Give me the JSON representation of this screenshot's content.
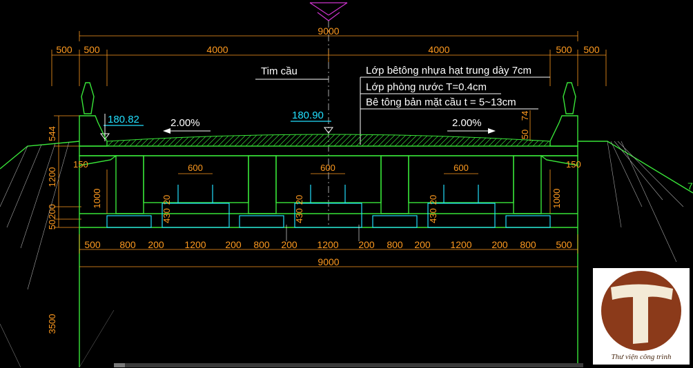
{
  "drawing": {
    "overall_width_top": "9000",
    "overall_width_bottom": "9000",
    "top_segments": [
      "500",
      "500",
      "4000",
      "4000",
      "500",
      "500"
    ],
    "bottom_segments": [
      "500",
      "800",
      "200",
      "1200",
      "200",
      "800",
      "200",
      "1200",
      "200",
      "800",
      "200",
      "1200",
      "200",
      "800",
      "500"
    ],
    "center_label": "Tim cầu",
    "layers": [
      "Lớp bêtông nhựa hạt trung dày 7cm",
      "Lớp phòng nước T=0.4cm",
      "Bê tông bản mặt cầu  t = 5~13cm"
    ],
    "elevation_left": "180.82",
    "elevation_center": "180.90",
    "slope_left": "2.00%",
    "slope_right": "2.00%",
    "dim_50": "50",
    "dim_74": "74",
    "dim_544": "544",
    "dim_1200": "1200",
    "dim_200": "200",
    "dim_50b": "50",
    "dim_3500": "3500",
    "dim_150_left": "150",
    "dim_150_right": "150",
    "dim_600": [
      "600",
      "600",
      "600"
    ],
    "dim_1000_left": "1000",
    "dim_1000_right": "1000",
    "dim_20": [
      "20",
      "20",
      "20"
    ],
    "dim_430": [
      "430",
      "430",
      "430"
    ],
    "edge_mark": "7"
  },
  "logo": {
    "letter": "T",
    "caption": "Thư viện công trình",
    "colors": {
      "brown": "#8b3a1a",
      "cream": "#f3ead6"
    }
  },
  "colors": {
    "background": "#000000",
    "structure": "#39e639",
    "dimension": "#ff9a1f",
    "annotation": "#ffffff",
    "elevation": "#22e0ff",
    "axis": "#cc33cc"
  }
}
